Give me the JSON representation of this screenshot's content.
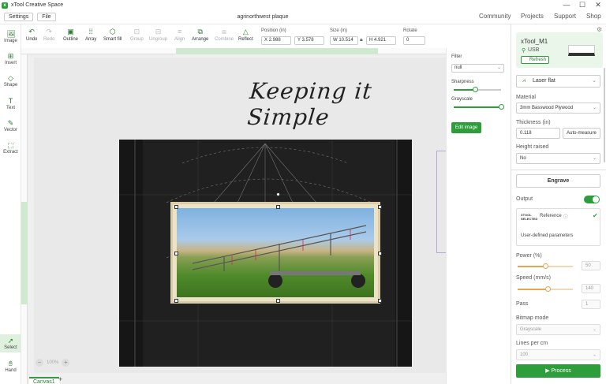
{
  "app": {
    "title": "xTool Creative Space",
    "logo_letter": "x"
  },
  "window_controls": {
    "minimize": "—",
    "maximize": "☐",
    "close": "✕"
  },
  "menu": {
    "settings": "Settings",
    "file": "File"
  },
  "document": {
    "title": "agrinorthwest plaque"
  },
  "nav": {
    "community": "Community",
    "projects": "Projects",
    "support": "Support",
    "shop": "Shop"
  },
  "toolbar": {
    "undo": "Undo",
    "redo": "Redo",
    "outline": "Outline",
    "array": "Array",
    "smart_fill": "Smart fill",
    "group": "Group",
    "ungroup": "Ungroup",
    "align": "Align",
    "arrange": "Arrange",
    "combine": "Combine",
    "reflect": "Reflect",
    "position_label": "Position (in)",
    "x_value": "X 2.988",
    "y_value": "Y 3.578",
    "size_label": "Size (in)",
    "w_value": "W 10.514",
    "h_value": "H 4.921",
    "rotate_label": "Rotate",
    "rotate_value": "0"
  },
  "left_tools": {
    "image": "Image",
    "insert": "Insert",
    "shape": "Shape",
    "text": "Text",
    "vector": "Vector",
    "extract": "Extract",
    "select": "Select",
    "hand": "Hand"
  },
  "canvas": {
    "text_content": "Keeping it Simple",
    "zoom_value": "100%",
    "zoom_out": "−",
    "zoom_in": "+",
    "tab_name": "Canvas1",
    "add_tab": "+"
  },
  "image_panel": {
    "filter_label": "Filter",
    "filter_value": "null",
    "sharpness_label": "Sharpness",
    "sharpness_level": 0.45,
    "grayscale_label": "Grayscale",
    "grayscale_level": 1.0,
    "edit_image": "Edit image"
  },
  "right_panel": {
    "device_name": "xTool_M1",
    "connection": "USB",
    "refresh": "Refresh",
    "mode": "Laser flat",
    "material_label": "Material",
    "material_value": "3mm Basswood Plywood",
    "thickness_label": "Thickness (in)",
    "thickness_value": "0.118",
    "auto_measure": "Auto-measure",
    "height_raised_label": "Height raised",
    "height_raised_value": "No",
    "engrave": "Engrave",
    "output_label": "Output",
    "xtool_badge": "XTOOL",
    "selected_badge": "SELECTED",
    "reference": "Reference",
    "user_defined": "User-defined parameters",
    "power_label": "Power (%)",
    "power_value": "50",
    "power_level": 0.5,
    "speed_label": "Speed (mm/s)",
    "speed_value": "140",
    "speed_level": 0.55,
    "pass_label": "Pass",
    "pass_value": "1",
    "bitmap_mode_label": "Bitmap mode",
    "bitmap_mode_value": "Grayscale",
    "lines_per_cm_label": "Lines per cm",
    "lines_per_cm_value": "100",
    "process": "Process"
  },
  "colors": {
    "accent": "#2e9e3c",
    "accent_light": "#eaf6ea",
    "canvas_bg": "#efefef"
  }
}
